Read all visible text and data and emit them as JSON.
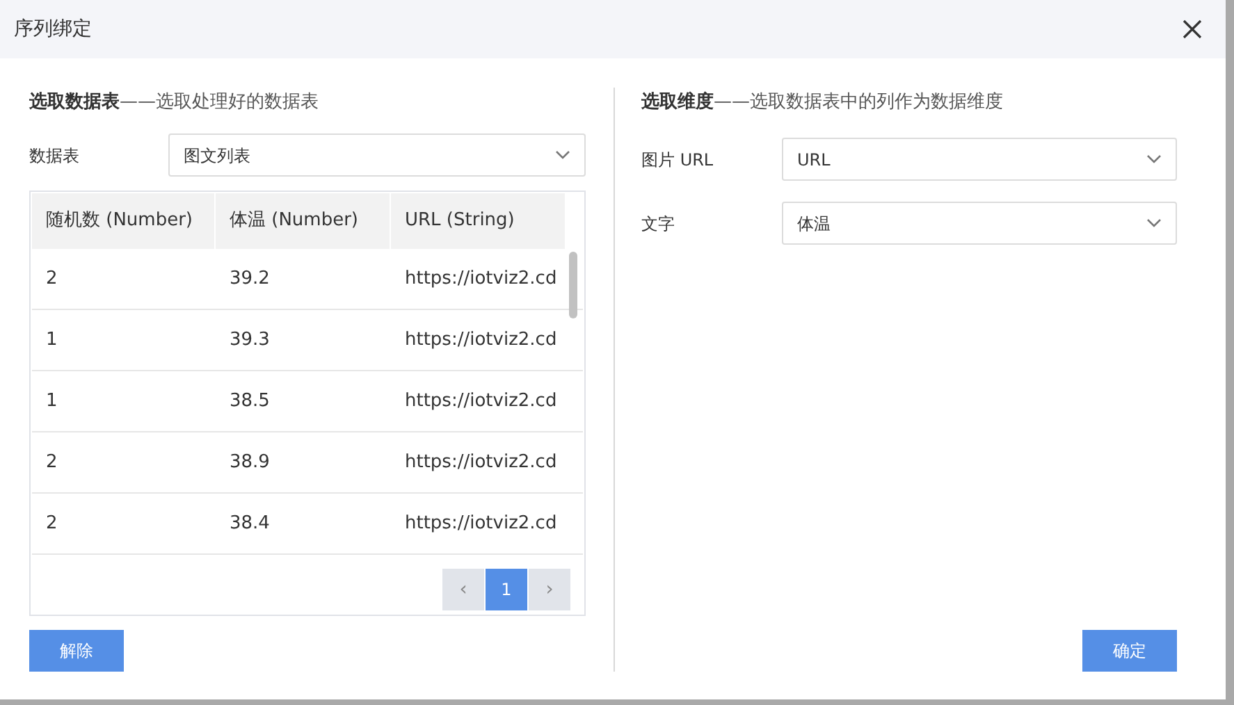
{
  "dialog": {
    "title": "序列绑定"
  },
  "left": {
    "heading": "选取数据表",
    "subheading": "——选取处理好的数据表",
    "table_select": {
      "label": "数据表",
      "value": "图文列表"
    },
    "table": {
      "columns": [
        "随机数 (Number)",
        "体温 (Number)",
        "URL (String)"
      ],
      "rows": [
        [
          "2",
          "39.2",
          "https://iotviz2.cd"
        ],
        [
          "1",
          "39.3",
          "https://iotviz2.cd"
        ],
        [
          "1",
          "38.5",
          "https://iotviz2.cd"
        ],
        [
          "2",
          "38.9",
          "https://iotviz2.cd"
        ],
        [
          "2",
          "38.4",
          "https://iotviz2.cd"
        ]
      ]
    },
    "pagination": {
      "prev": "‹",
      "next": "›",
      "pages": [
        {
          "label": "1",
          "selected": true
        }
      ]
    },
    "button": "解除"
  },
  "right": {
    "heading": "选取维度",
    "subheading": "——选取数据表中的列作为数据维度",
    "fields": [
      {
        "label": "图片 URL",
        "value": "URL"
      },
      {
        "label": "文字",
        "value": "体温"
      }
    ],
    "button": "确定"
  }
}
